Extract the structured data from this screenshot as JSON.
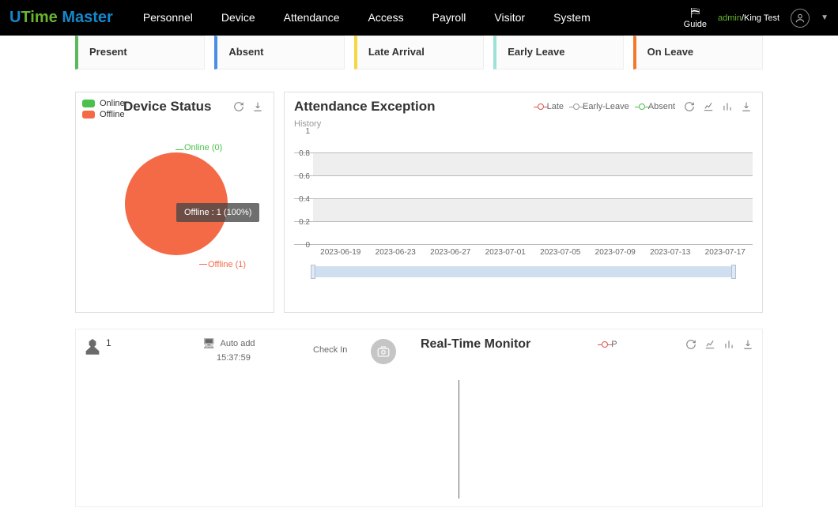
{
  "header": {
    "logo": {
      "u": "U",
      "time": "Time",
      "master": " Master"
    },
    "nav": [
      "Personnel",
      "Device",
      "Attendance",
      "Access",
      "Payroll",
      "Visitor",
      "System"
    ],
    "guide_label": "Guide",
    "user_admin": "admin",
    "user_sep": "/",
    "user_name": "King Test"
  },
  "stats": {
    "present": "Present",
    "absent": "Absent",
    "late": "Late Arrival",
    "early": "Early Leave",
    "leave": "On Leave"
  },
  "device_panel": {
    "title": "Device Status",
    "legend_online": "Online",
    "legend_offline": "Offline",
    "label_online": "Online (0)",
    "label_offline": "Offline (1)",
    "tooltip": "Offline : 1 (100%)"
  },
  "attend_panel": {
    "title": "Attendance Exception",
    "history": "History",
    "legend": {
      "late": "Late",
      "early": "Early-Leave",
      "absent": "Absent"
    }
  },
  "chart_data": {
    "type": "line",
    "x": [
      "2023-06-19",
      "2023-06-23",
      "2023-06-27",
      "2023-07-01",
      "2023-07-05",
      "2023-07-09",
      "2023-07-13",
      "2023-07-17"
    ],
    "series": [
      {
        "name": "Late",
        "values": [
          0,
          0,
          0,
          0,
          0,
          0,
          0,
          0
        ]
      },
      {
        "name": "Early-Leave",
        "values": [
          0,
          0,
          0,
          0,
          0,
          0,
          0,
          0
        ]
      },
      {
        "name": "Absent",
        "values": [
          0,
          0,
          0,
          0,
          0,
          0,
          0,
          0
        ]
      }
    ],
    "ylim": [
      0,
      1
    ],
    "yticks": [
      0,
      0.2,
      0.4,
      0.6,
      0.8,
      1
    ]
  },
  "lower": {
    "user_id": "1",
    "auto_add": "Auto add",
    "time": "15:37:59",
    "check_in": "Check In",
    "rtm_title": "Real-Time Monitor",
    "rtm_legend_p": "P"
  },
  "colors": {
    "online": "#4ac14a",
    "offline": "#f46a47",
    "late": "#d9534f",
    "early": "#999999",
    "absent": "#4ac14a"
  }
}
